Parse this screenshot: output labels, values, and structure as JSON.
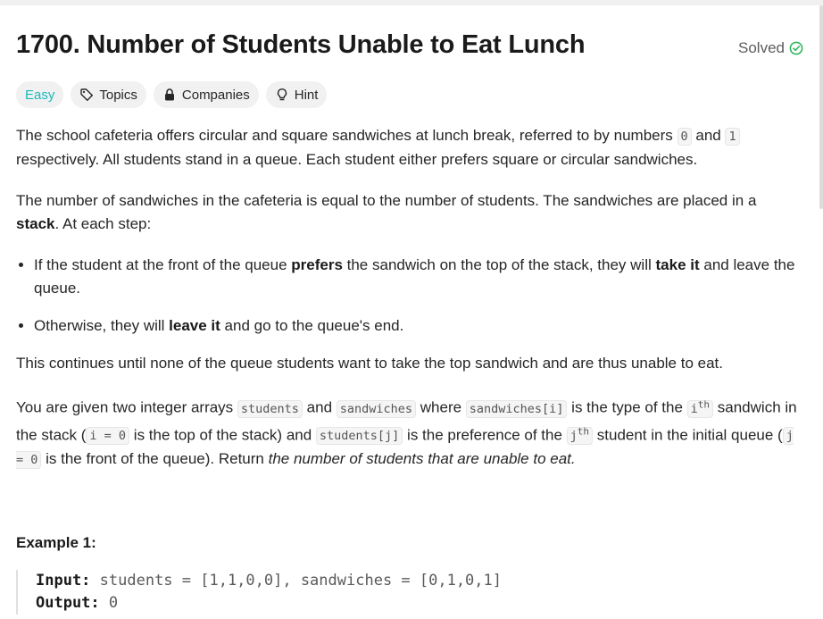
{
  "problem": {
    "title": "1700. Number of Students Unable to Eat Lunch",
    "status": "Solved",
    "difficulty": "Easy"
  },
  "tags": {
    "topics": "Topics",
    "companies": "Companies",
    "hint": "Hint"
  },
  "description": {
    "p1_a": "The school cafeteria offers circular and square sandwiches at lunch break, referred to by numbers ",
    "p1_code0": "0",
    "p1_b": " and ",
    "p1_code1": "1",
    "p1_c": " respectively. All students stand in a queue. Each student either prefers square or circular sandwiches.",
    "p2_a": "The number of sandwiches in the cafeteria is equal to the number of students. The sandwiches are placed in a ",
    "p2_bold": "stack",
    "p2_b": ". At each step:",
    "b1_a": "If the student at the front of the queue ",
    "b1_bold1": "prefers",
    "b1_b": " the sandwich on the top of the stack, they will ",
    "b1_bold2": "take it",
    "b1_c": " and leave the queue.",
    "b2_a": "Otherwise, they will ",
    "b2_bold": "leave it",
    "b2_b": " and go to the queue's end.",
    "p3": "This continues until none of the queue students want to take the top sandwich and are thus unable to eat.",
    "p4_a": "You are given two integer arrays ",
    "p4_code_students": "students",
    "p4_b": " and ",
    "p4_code_sandwiches": "sandwiches",
    "p4_c": " where ",
    "p4_code_sandwiches_i": "sandwiches[i]",
    "p4_d": " is the type of the ",
    "p4_i": "i",
    "p4_th1": "th",
    "p4_e": " sandwich in the stack (",
    "p4_code_i0": "i = 0",
    "p4_f": " is the top of the stack) and ",
    "p4_code_students_j": "students[j]",
    "p4_g": " is the preference of the ",
    "p4_j": "j",
    "p4_th2": "th",
    "p4_h": " student in the initial queue (",
    "p4_code_j0": "j = 0",
    "p4_k": " is the front of the queue). Return ",
    "p4_italic": "the number of students that are unable to eat.",
    "p4_end": ""
  },
  "example1": {
    "title": "Example 1:",
    "input_label": "Input:",
    "input_value": " students = [1,1,0,0], sandwiches = [0,1,0,1]",
    "output_label": "Output:",
    "output_value": " 0"
  },
  "colors": {
    "easy": "#1cb8b8",
    "solved_check": "#2db55d"
  }
}
